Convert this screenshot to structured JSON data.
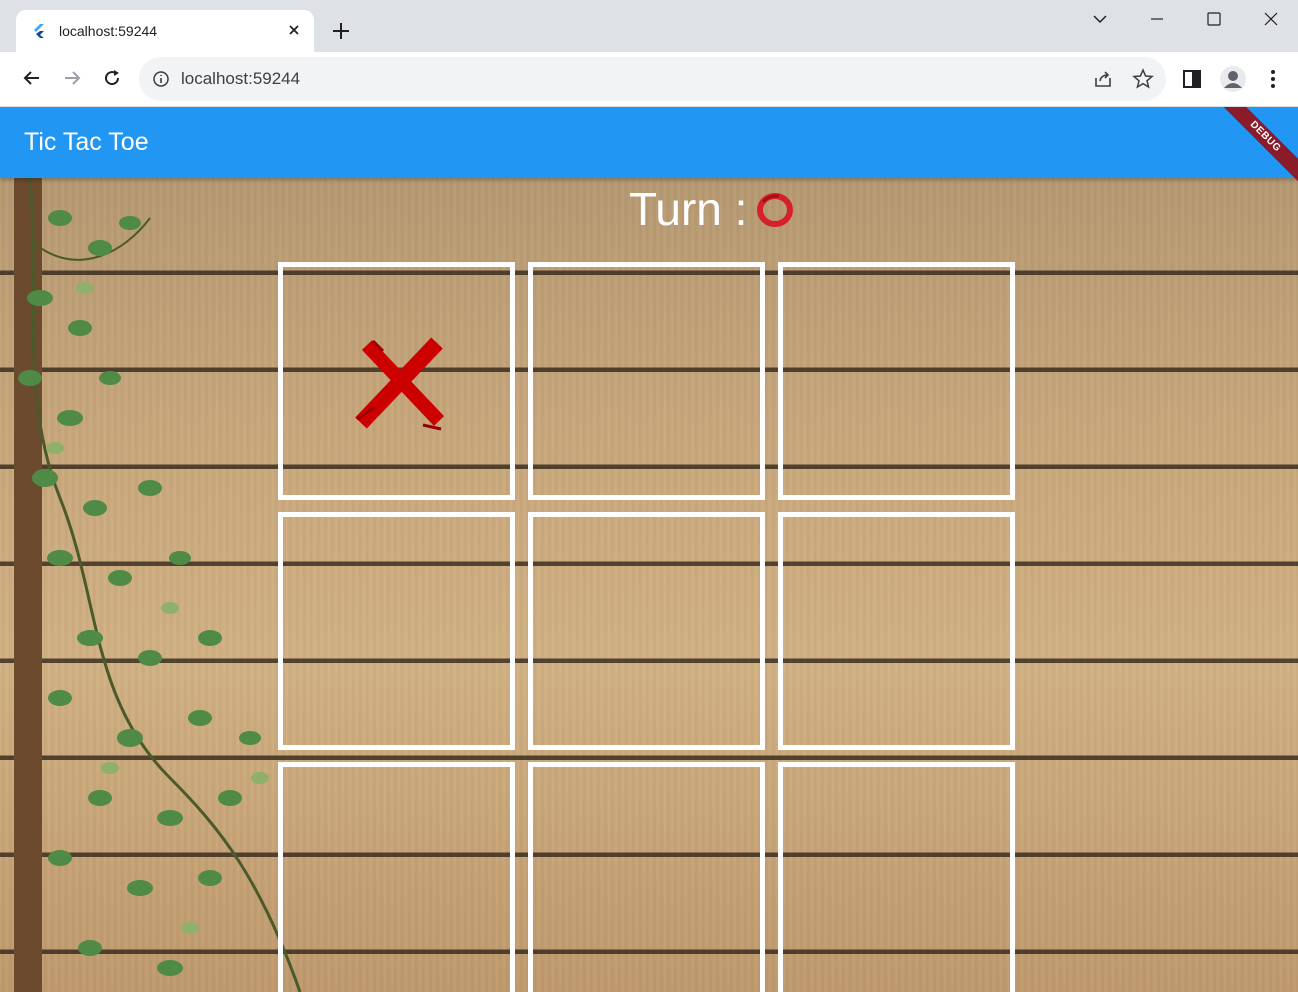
{
  "browser": {
    "tab_title": "localhost:59244",
    "url": "localhost:59244"
  },
  "app": {
    "title": "Tic Tac Toe",
    "debug_label": "DEBUG",
    "turn_label": "Turn :",
    "current_turn": "O"
  },
  "board": {
    "cells": [
      "X",
      "",
      "",
      "",
      "",
      "",
      "",
      "",
      ""
    ]
  },
  "colors": {
    "appbar": "#2196f3",
    "x_mark": "#cc0000",
    "o_mark": "#d6202a",
    "grid_lines": "#ffffff"
  }
}
